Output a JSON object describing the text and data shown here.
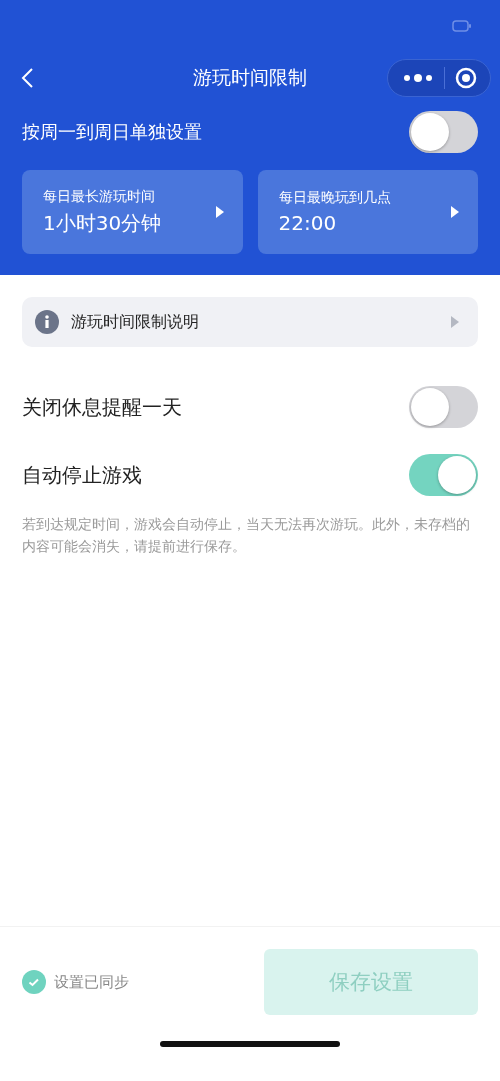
{
  "nav": {
    "title": "游玩时间限制"
  },
  "weekly": {
    "label": "按周一到周日单独设置",
    "on": false
  },
  "cards": [
    {
      "label": "每日最长游玩时间",
      "value": "1小时30分钟"
    },
    {
      "label": "每日最晚玩到几点",
      "value": "22:00"
    }
  ],
  "info": {
    "label": "游玩时间限制说明"
  },
  "settings": [
    {
      "label": "关闭休息提醒一天",
      "on": false
    },
    {
      "label": "自动停止游戏",
      "on": true
    }
  ],
  "note": "若到达规定时间，游戏会自动停止，当天无法再次游玩。此外，未存档的内容可能会消失，请提前进行保存。",
  "footer": {
    "status": "设置已同步",
    "button": {
      "label": "保存设置",
      "disabled": true
    }
  }
}
